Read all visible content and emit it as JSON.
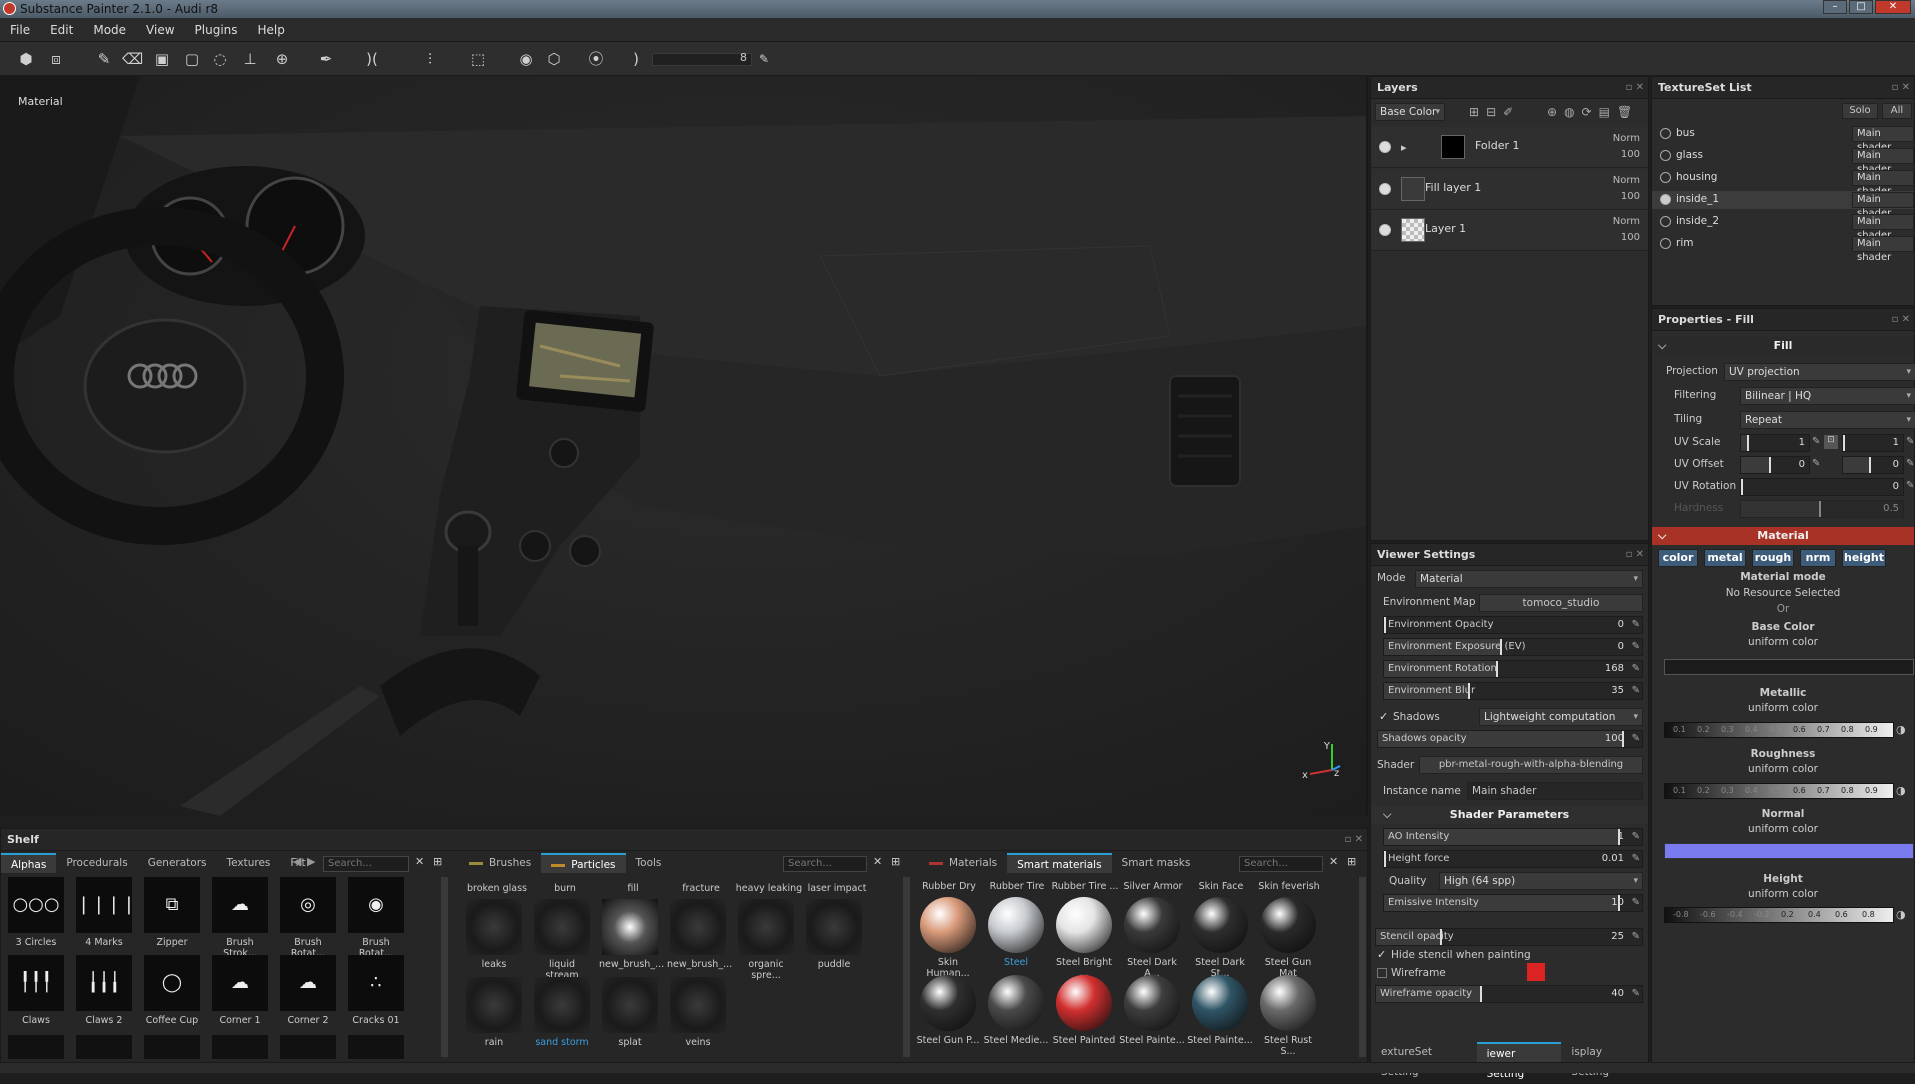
{
  "window": {
    "title": "Substance Painter 2.1.0 - Audi r8",
    "min": "–",
    "max": "□",
    "close": "✕"
  },
  "menu": [
    "File",
    "Edit",
    "Mode",
    "View",
    "Plugins",
    "Help"
  ],
  "toolbar": {
    "brush_size_value": "8",
    "icons": [
      "paint-brush-icon",
      "eraser-icon",
      "projection-icon",
      "polygon-fill-icon",
      "smudge-icon",
      "clone-icon",
      "material-picker-icon",
      "pen-icon",
      "symmetry-icon",
      "camera-icon",
      "screenshot-icon"
    ]
  },
  "viewport": {
    "mode_label": "Material",
    "gizmo": {
      "x": "x",
      "y": "Y",
      "z": "z"
    }
  },
  "layers": {
    "title": "Layers",
    "channel": "Base Color",
    "items": [
      {
        "name": "Folder 1",
        "blend": "Norm",
        "opacity": "100"
      },
      {
        "name": "Fill layer 1",
        "blend": "Norm",
        "opacity": "100"
      },
      {
        "name": "Layer 1",
        "blend": "Norm",
        "opacity": "100"
      }
    ]
  },
  "textureset": {
    "title": "TextureSet List",
    "solo": "Solo",
    "all": "All",
    "items": [
      {
        "name": "bus",
        "shader": "Main shader"
      },
      {
        "name": "glass",
        "shader": "Main shader"
      },
      {
        "name": "housing",
        "shader": "Main shader"
      },
      {
        "name": "inside_1",
        "shader": "Main shader"
      },
      {
        "name": "inside_2",
        "shader": "Main shader"
      },
      {
        "name": "rim",
        "shader": "Main shader"
      }
    ]
  },
  "properties": {
    "title": "Properties - Fill",
    "fill_section": "Fill",
    "projection_label": "Projection",
    "projection_value": "UV projection",
    "filtering_label": "Filtering",
    "filtering_value": "Bilinear | HQ",
    "tiling_label": "Tiling",
    "tiling_value": "Repeat",
    "uvscale_label": "UV Scale",
    "uvscale_a": "1",
    "uvscale_b": "1",
    "uvoffset_label": "UV Offset",
    "uvoffset_a": "0",
    "uvoffset_b": "0",
    "uvrotation_label": "UV Rotation",
    "uvrotation_value": "0",
    "hardness_label": "Hardness",
    "hardness_value": "0.5",
    "material_section": "Material",
    "channels": [
      "color",
      "metal",
      "rough",
      "nrm",
      "height"
    ],
    "material_mode_title": "Material mode",
    "material_mode_value": "No Resource Selected",
    "or": "Or",
    "base_color_title": "Base Color",
    "base_color_sub": "uniform color",
    "metallic_title": "Metallic",
    "metallic_sub": "uniform color",
    "roughness_title": "Roughness",
    "roughness_sub": "uniform color",
    "normal_title": "Normal",
    "normal_sub": "uniform color",
    "height_title": "Height",
    "height_sub": "uniform color",
    "ramp_ticks": [
      "0.1",
      "0.2",
      "0.3",
      "0.4",
      "0.5",
      "0.6",
      "0.7",
      "0.8",
      "0.9"
    ],
    "height_ticks": [
      "-0.8",
      "-0.6",
      "-0.4",
      "-0.2",
      "0.2",
      "0.4",
      "0.6",
      "0.8"
    ],
    "normal_color": "#7b7bf0"
  },
  "viewer": {
    "title": "Viewer Settings",
    "mode_label": "Mode",
    "mode_value": "Material",
    "envmap_label": "Environment Map",
    "envmap_value": "tomoco_studio",
    "env_opacity_label": "Environment Opacity",
    "env_opacity": "0",
    "env_exposure_label": "Environment Exposure (EV)",
    "env_exposure": "0",
    "env_rotation_label": "Environment Rotation",
    "env_rotation": "168",
    "env_blur_label": "Environment Blur",
    "env_blur": "35",
    "shadows_label": "Shadows",
    "shadows_value": "Lightweight computation",
    "shadows_opacity_label": "Shadows opacity",
    "shadows_opacity": "100",
    "shader_label": "Shader",
    "shader_value": "pbr-metal-rough-with-alpha-blending",
    "instance_label": "Instance name",
    "instance_value": "Main shader",
    "shader_params": "Shader Parameters",
    "ao_label": "AO Intensity",
    "ao": "1",
    "height_force_label": "Height force",
    "height_force": "0.01",
    "quality_label": "Quality",
    "quality_value": "High (64 spp)",
    "emissive_label": "Emissive Intensity",
    "emissive": "10",
    "stencil_label": "Stencil opacity",
    "stencil": "25",
    "hide_stencil_label": "Hide stencil when painting",
    "wireframe_label": "Wireframe",
    "wireframe_color": "#dd2222",
    "wire_opacity_label": "Wireframe opacity",
    "wire_opacity": "40",
    "bottom_tabs": [
      "extureSet Setting",
      "iewer Setting",
      "isplay Setting"
    ]
  },
  "shelf": {
    "title": "Shelf",
    "tabs": [
      "Alphas",
      "Procedurals",
      "Generators",
      "Textures",
      "Filt"
    ],
    "search_placeholder": "Search...",
    "alphas": [
      "3 Circles",
      "4 Marks",
      "Zipper",
      "Brush Strok...",
      "Brush Rotat...",
      "Brush Rotat...",
      "Claws",
      "Claws 2",
      "Coffee Cup",
      "Corner 1",
      "Corner 2",
      "Cracks 01"
    ],
    "mid_tabs": [
      "Brushes",
      "Particles",
      "Tools"
    ],
    "particles_top": [
      "broken glass",
      "burn",
      "fill",
      "fracture",
      "heavy leaking",
      "laser impact"
    ],
    "particles": [
      "leaks",
      "liquid stream",
      "new_brush_...",
      "new_brush_...",
      "organic spre...",
      "puddle",
      "rain",
      "sand storm",
      "splat",
      "veins"
    ],
    "mat_tabs": [
      "Materials",
      "Smart materials",
      "Smart masks"
    ],
    "smart_top": [
      "Rubber Dry",
      "Rubber Tire",
      "Rubber Tire ...",
      "Silver Armor",
      "Skin Face",
      "Skin feverish"
    ],
    "smart": [
      "Skin Human...",
      "Steel",
      "Steel Bright ...",
      "Steel Dark A...",
      "Steel Dark St...",
      "Steel Gun Mat",
      "Steel Gun P...",
      "Steel Medie...",
      "Steel Painted",
      "Steel Painte...",
      "Steel Painte...",
      "Steel Rust S..."
    ]
  }
}
